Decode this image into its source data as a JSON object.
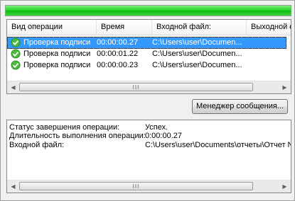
{
  "progress": {
    "value": 1.0,
    "color": "#22c822"
  },
  "list": {
    "columns": [
      "Вид операции",
      "Время",
      "Входной файл:",
      "Выходной ф"
    ],
    "rows": [
      {
        "icon": "check-icon",
        "operation": "Проверка подписи",
        "time": "00:00:00.27",
        "input": "C:\\Users\\user\\Documen...",
        "selected": true
      },
      {
        "icon": "check-icon",
        "operation": "Проверка подписи",
        "time": "00:00:01.22",
        "input": "C:\\Users\\user\\Documen...",
        "selected": false
      },
      {
        "icon": "check-icon",
        "operation": "Проверка подписи",
        "time": "00:00:00.23",
        "input": "C:\\Users\\user\\Documen...",
        "selected": false
      }
    ],
    "selection_color": "#3399ff"
  },
  "message_manager_button": "Менеджер сообщения...",
  "details": {
    "status_label": "Статус завершения операции:",
    "status_value": "Успех.",
    "duration_label": "Длительность выполнения операции:",
    "duration_value": "0:00:00.27",
    "input_label": "Входной файл:",
    "input_value": "C:\\Users\\user\\Documents\\отчеты\\Отчет N"
  },
  "scrollbar_thumb_grip": "III"
}
